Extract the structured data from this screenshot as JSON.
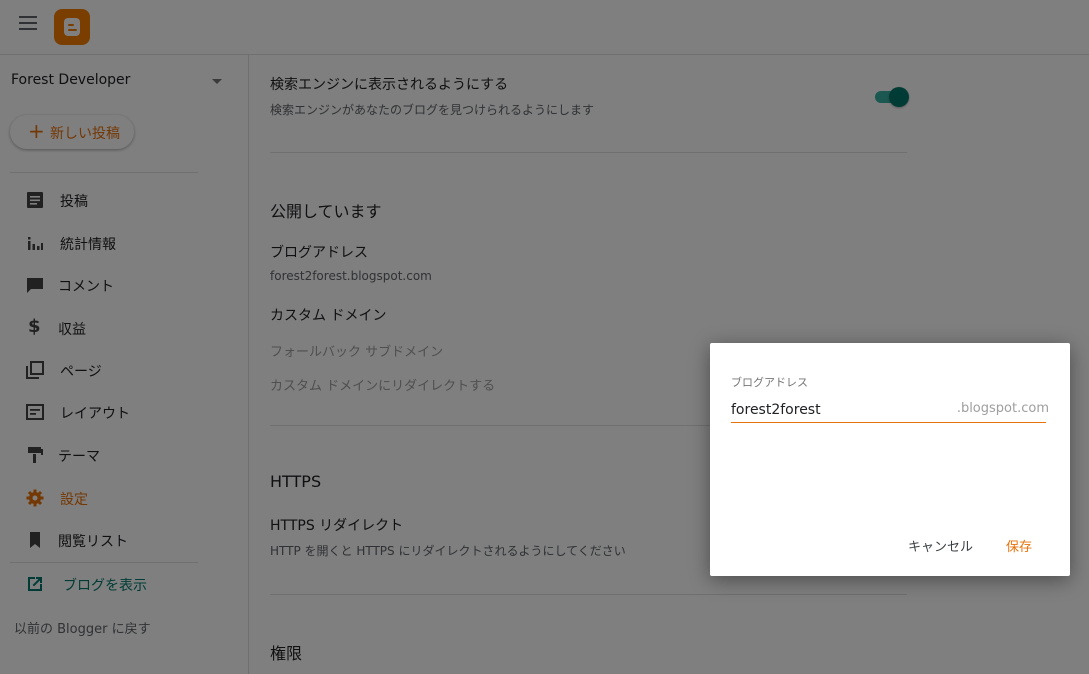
{
  "header": {
    "menu_icon": "hamburger-menu-icon",
    "logo_icon": "blogger-logo-icon"
  },
  "sidebar": {
    "blog_name": "Forest Developer",
    "new_post_label": "新しい投稿",
    "items": [
      {
        "label": "投稿",
        "icon": "posts-icon"
      },
      {
        "label": "統計情報",
        "icon": "stats-icon"
      },
      {
        "label": "コメント",
        "icon": "comment-icon"
      },
      {
        "label": "収益",
        "icon": "dollar-icon"
      },
      {
        "label": "ページ",
        "icon": "pages-icon"
      },
      {
        "label": "レイアウト",
        "icon": "layout-icon"
      },
      {
        "label": "テーマ",
        "icon": "theme-icon"
      },
      {
        "label": "設定",
        "icon": "gear-icon",
        "active": true
      },
      {
        "label": "閲覧リスト",
        "icon": "bookmark-icon"
      }
    ],
    "view_blog_label": "ブログを表示",
    "back_label": "以前の Blogger に戻す"
  },
  "main": {
    "search_title": "検索エンジンに表示されるようにする",
    "search_sub": "検索エンジンがあなたのブログを見つけられるようにします",
    "search_toggle_on": true,
    "publishing_head": "公開しています",
    "blog_address_label": "ブログアドレス",
    "blog_address_value": "forest2forest.blogspot.com",
    "custom_domain_label": "カスタム ドメイン",
    "fallback_label": "フォールバック サブドメイン",
    "redirect_label": "カスタム ドメインにリダイレクトする",
    "https_head": "HTTPS",
    "https_redirect_title": "HTTPS リダイレクト",
    "https_redirect_sub": "HTTP を開くと HTTPS にリダイレクトされるようにしてください",
    "permissions_head": "権限"
  },
  "dialog": {
    "label": "ブログアドレス",
    "value": "forest2forest",
    "suffix": ".blogspot.com",
    "cancel_label": "キャンセル",
    "save_label": "保存"
  },
  "colors": {
    "accent": "#e8710a",
    "teal": "#00796b",
    "brand": "#f57d00"
  }
}
